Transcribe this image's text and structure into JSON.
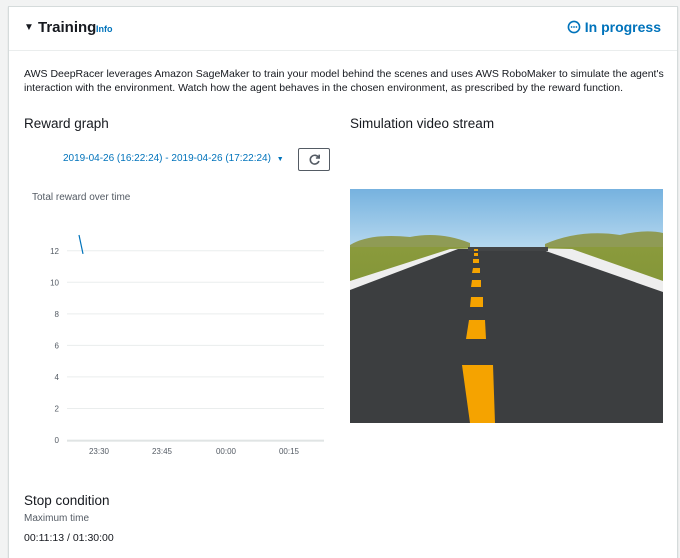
{
  "header": {
    "title": "Training",
    "info_link": "Info",
    "status": "In progress"
  },
  "description": "AWS DeepRacer leverages Amazon SageMaker to train your model behind the scenes and uses AWS RoboMaker to simulate the agent's interaction with the environment. Watch how the agent behaves in the chosen environment, as prescribed by the reward function.",
  "reward_graph": {
    "heading": "Reward graph",
    "date_range": "2019-04-26 (16:22:24) - 2019-04-26 (17:22:24)",
    "chart_title": "Total reward over time"
  },
  "simulation": {
    "heading": "Simulation video stream"
  },
  "stop_condition": {
    "heading": "Stop condition",
    "label": "Maximum time",
    "value": "00:11:13 / 01:30:00"
  },
  "colors": {
    "link": "#0073bb",
    "line": "#0073bb",
    "grid": "#eaeded"
  },
  "chart_data": {
    "type": "line",
    "title": "Total reward over time",
    "xlabel": "",
    "ylabel": "",
    "x_ticks": [
      "23:30",
      "23:45",
      "00:00",
      "00:15"
    ],
    "y_ticks": [
      "0",
      "2",
      "4",
      "6",
      "8",
      "10",
      "12"
    ],
    "ylim": [
      0,
      13
    ],
    "grid": true,
    "series": [
      {
        "values": [
          13.0,
          11.8
        ]
      }
    ]
  }
}
